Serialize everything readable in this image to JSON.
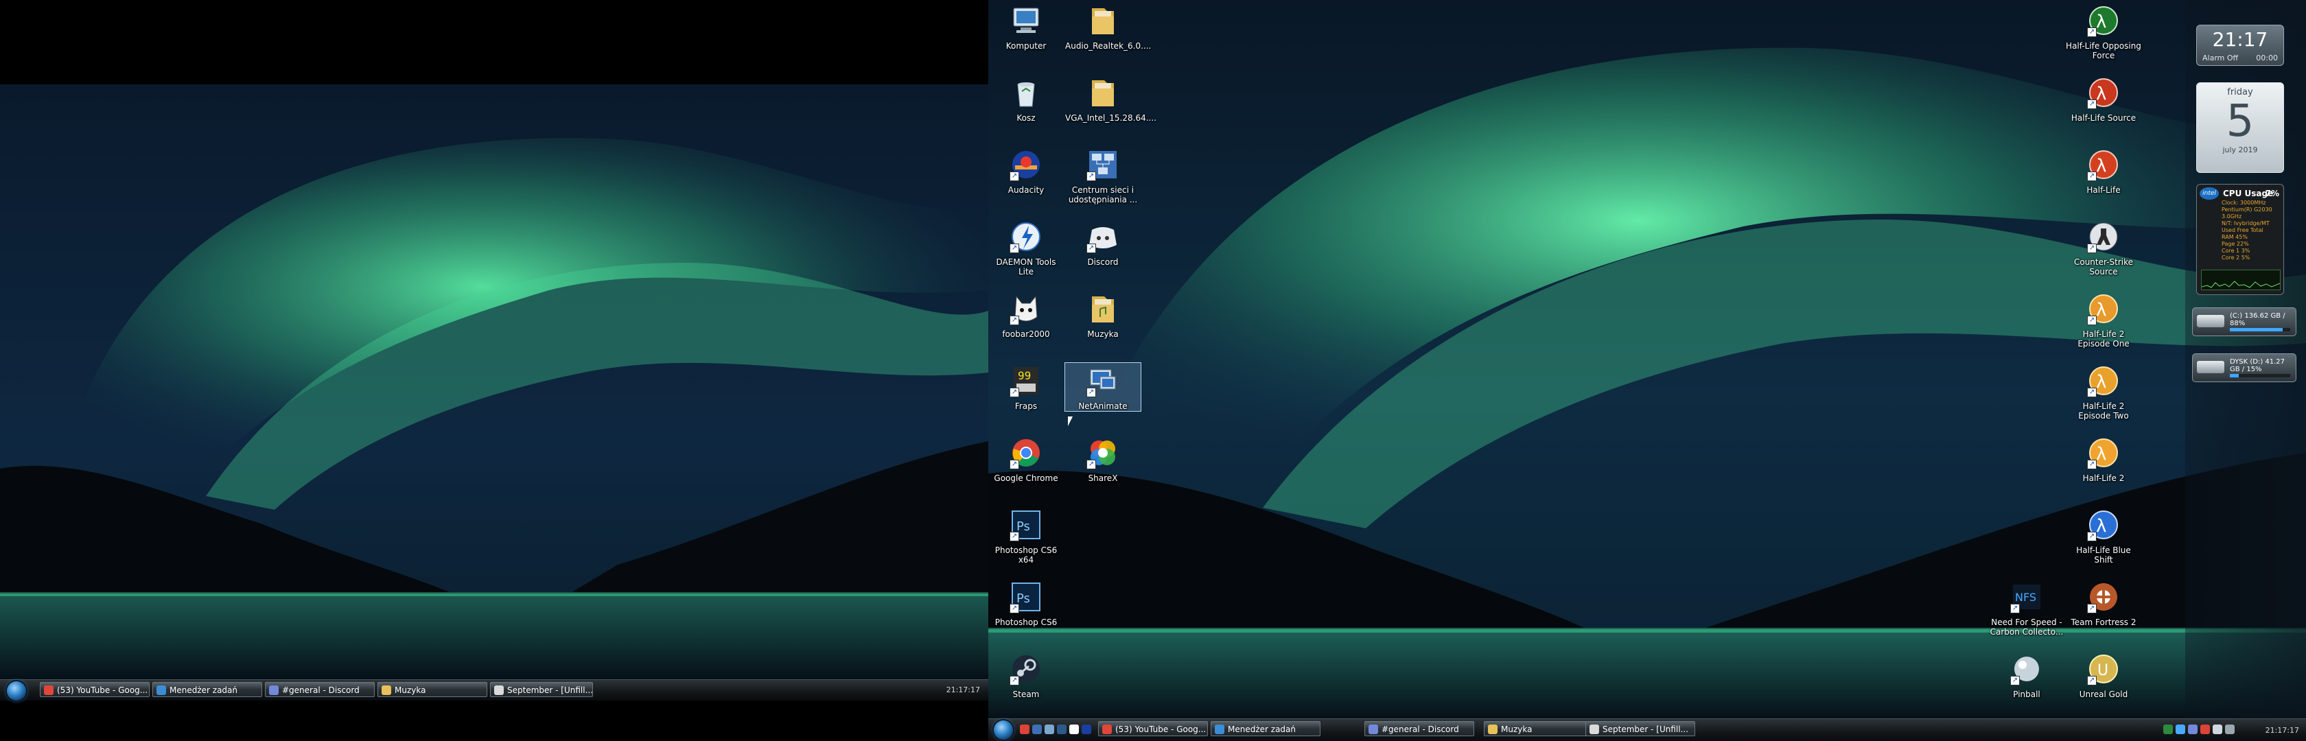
{
  "left_monitor": {
    "taskbar": {
      "tasks": [
        {
          "label": "(53) YouTube - Goog...",
          "icon": "chrome-icon",
          "color": "#e0473a"
        },
        {
          "label": "Menedżer zadań",
          "icon": "task-manager-icon",
          "color": "#3b8ed6"
        },
        {
          "label": "#general - Discord",
          "icon": "discord-icon",
          "color": "#7289da"
        },
        {
          "label": "Muzyka",
          "icon": "folder-icon",
          "color": "#e8c15a"
        },
        {
          "label": "September - [Unfill...",
          "icon": "foobar-icon",
          "color": "#dadada"
        }
      ],
      "time": "21:17:17"
    }
  },
  "desktop_icons_left": [
    {
      "label": "Komputer",
      "icon": "computer-icon"
    },
    {
      "label": "Audio_Realtek_6.0....",
      "icon": "folder-icon"
    },
    {
      "label": "Kosz",
      "icon": "recycle-bin-icon"
    },
    {
      "label": "VGA_Intel_15.28.64....",
      "icon": "folder-icon"
    },
    {
      "label": "Audacity",
      "icon": "audacity-icon"
    },
    {
      "label": "Centrum sieci i udostępniania ...",
      "icon": "network-center-icon"
    },
    {
      "label": "DAEMON Tools Lite",
      "icon": "daemon-tools-icon"
    },
    {
      "label": "Discord",
      "icon": "discord-icon"
    },
    {
      "label": "foobar2000",
      "icon": "foobar-icon"
    },
    {
      "label": "Muzyka",
      "icon": "folder-icon"
    },
    {
      "label": "Fraps",
      "icon": "fraps-icon"
    },
    {
      "label": "NetAnimate",
      "icon": "netanimate-icon"
    },
    {
      "label": "Google Chrome",
      "icon": "chrome-icon"
    },
    {
      "label": "ShareX",
      "icon": "sharex-icon"
    },
    {
      "label": "Photoshop CS6 x64",
      "icon": "photoshop-icon"
    },
    {
      "label": "Photoshop CS6",
      "icon": "photoshop-icon"
    },
    {
      "label": "Steam",
      "icon": "steam-icon"
    }
  ],
  "desktop_icons_right": [
    {
      "label": "Half-Life Opposing Force",
      "icon": "half-life-of-icon"
    },
    {
      "label": "Half-Life Source",
      "icon": "half-life-source-icon"
    },
    {
      "label": "Half-Life",
      "icon": "half-life-icon"
    },
    {
      "label": "Counter-Strike Source",
      "icon": "counter-strike-icon"
    },
    {
      "label": "Half-Life 2 Episode One",
      "icon": "half-life-2-ep1-icon"
    },
    {
      "label": "Half-Life 2 Episode Two",
      "icon": "half-life-2-ep2-icon"
    },
    {
      "label": "Half-Life 2",
      "icon": "half-life-2-icon"
    },
    {
      "label": "Half-Life Blue Shift",
      "icon": "half-life-blue-shift-icon"
    },
    {
      "label": "Need For Speed - Carbon Collecto...",
      "icon": "nfs-icon"
    },
    {
      "label": "Team Fortress 2",
      "icon": "team-fortress-icon"
    },
    {
      "label": "Pinball",
      "icon": "pinball-icon"
    },
    {
      "label": "Unreal Gold",
      "icon": "unreal-icon"
    }
  ],
  "gadgets": {
    "clock": {
      "time": "21:17",
      "alarm": "Alarm Off",
      "alarm_time": "00:00"
    },
    "calendar": {
      "day_name": "friday",
      "day": "5",
      "month": "july 2019"
    },
    "cpu": {
      "title": "CPU Usage",
      "percent": "7%",
      "brand": "intel",
      "lines": [
        "Clock: 3000MHz",
        "Pentium(R) G2030 3.0GHz",
        "N/T: Ivybridge/MT",
        "Used   Free  Total",
        "RAM 45%",
        "Page 22%",
        "Core 1 3%",
        "Core 2 5%"
      ]
    },
    "drives": [
      {
        "label": "(C:)",
        "usage": "136.62 GB / 88%",
        "fill": 0.88
      },
      {
        "label": "DYSK (D:)",
        "usage": "41.27 GB / 15%",
        "fill": 0.15
      }
    ]
  },
  "right_monitor": {
    "taskbar": {
      "tasks": [
        {
          "label": "(53) YouTube - Goog...",
          "icon": "chrome-icon",
          "color": "#e0473a"
        },
        {
          "label": "Menedżer zadań",
          "icon": "task-manager-icon",
          "color": "#3b8ed6"
        },
        {
          "label": "#general - Discord",
          "icon": "discord-icon",
          "color": "#7289da"
        },
        {
          "label": "Muzyka",
          "icon": "folder-icon",
          "color": "#e8c15a"
        },
        {
          "label": "September - [Unfill...",
          "icon": "foobar-icon",
          "color": "#dadada"
        }
      ],
      "time": "21:17:17"
    }
  },
  "colors": {
    "aurora": "#3fd68b",
    "sky": "#0b1a2b",
    "water": "#102a3a"
  }
}
